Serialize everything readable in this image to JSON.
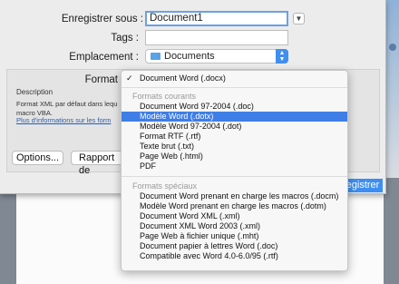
{
  "sheet": {
    "save_as_label": "Enregistrer sous :",
    "filename": "Document1",
    "tags_label": "Tags :",
    "tags_value": "",
    "location_label": "Emplacement :",
    "location_value": "Documents",
    "format_label": "Format",
    "description_title": "Description",
    "description_text": "Format XML par défaut dans lequ",
    "description_text2": "macro VBA.",
    "more_info_link": "Plus d'informations sur les form",
    "options_button": "Options...",
    "compat_button": "Rapport de",
    "save_button": "registrer"
  },
  "menu": {
    "current": "Document Word (.docx)",
    "section1": "Formats courants",
    "common": [
      "Document Word 97-2004 (.doc)",
      "Modèle Word (.dotx)",
      "Modèle Word 97-2004 (.dot)",
      "Format RTF (.rtf)",
      "Texte brut (.txt)",
      "Page Web (.html)",
      "PDF"
    ],
    "section2": "Formats spéciaux",
    "special": [
      "Document Word prenant en charge les macros (.docm)",
      "Modèle Word prenant en charge les macros (.dotm)",
      "Document Word XML (.xml)",
      "Document XML Word 2003 (.xml)",
      "Page Web à fichier unique (.mht)",
      "Document papier à lettres Word (.doc)",
      "Compatible avec Word 4.0-6.0/95 (.rtf)"
    ],
    "selected": "Modèle Word (.dotx)"
  },
  "colors": {
    "accent": "#3f7ee6",
    "primary_button": "#3d8ef2"
  }
}
